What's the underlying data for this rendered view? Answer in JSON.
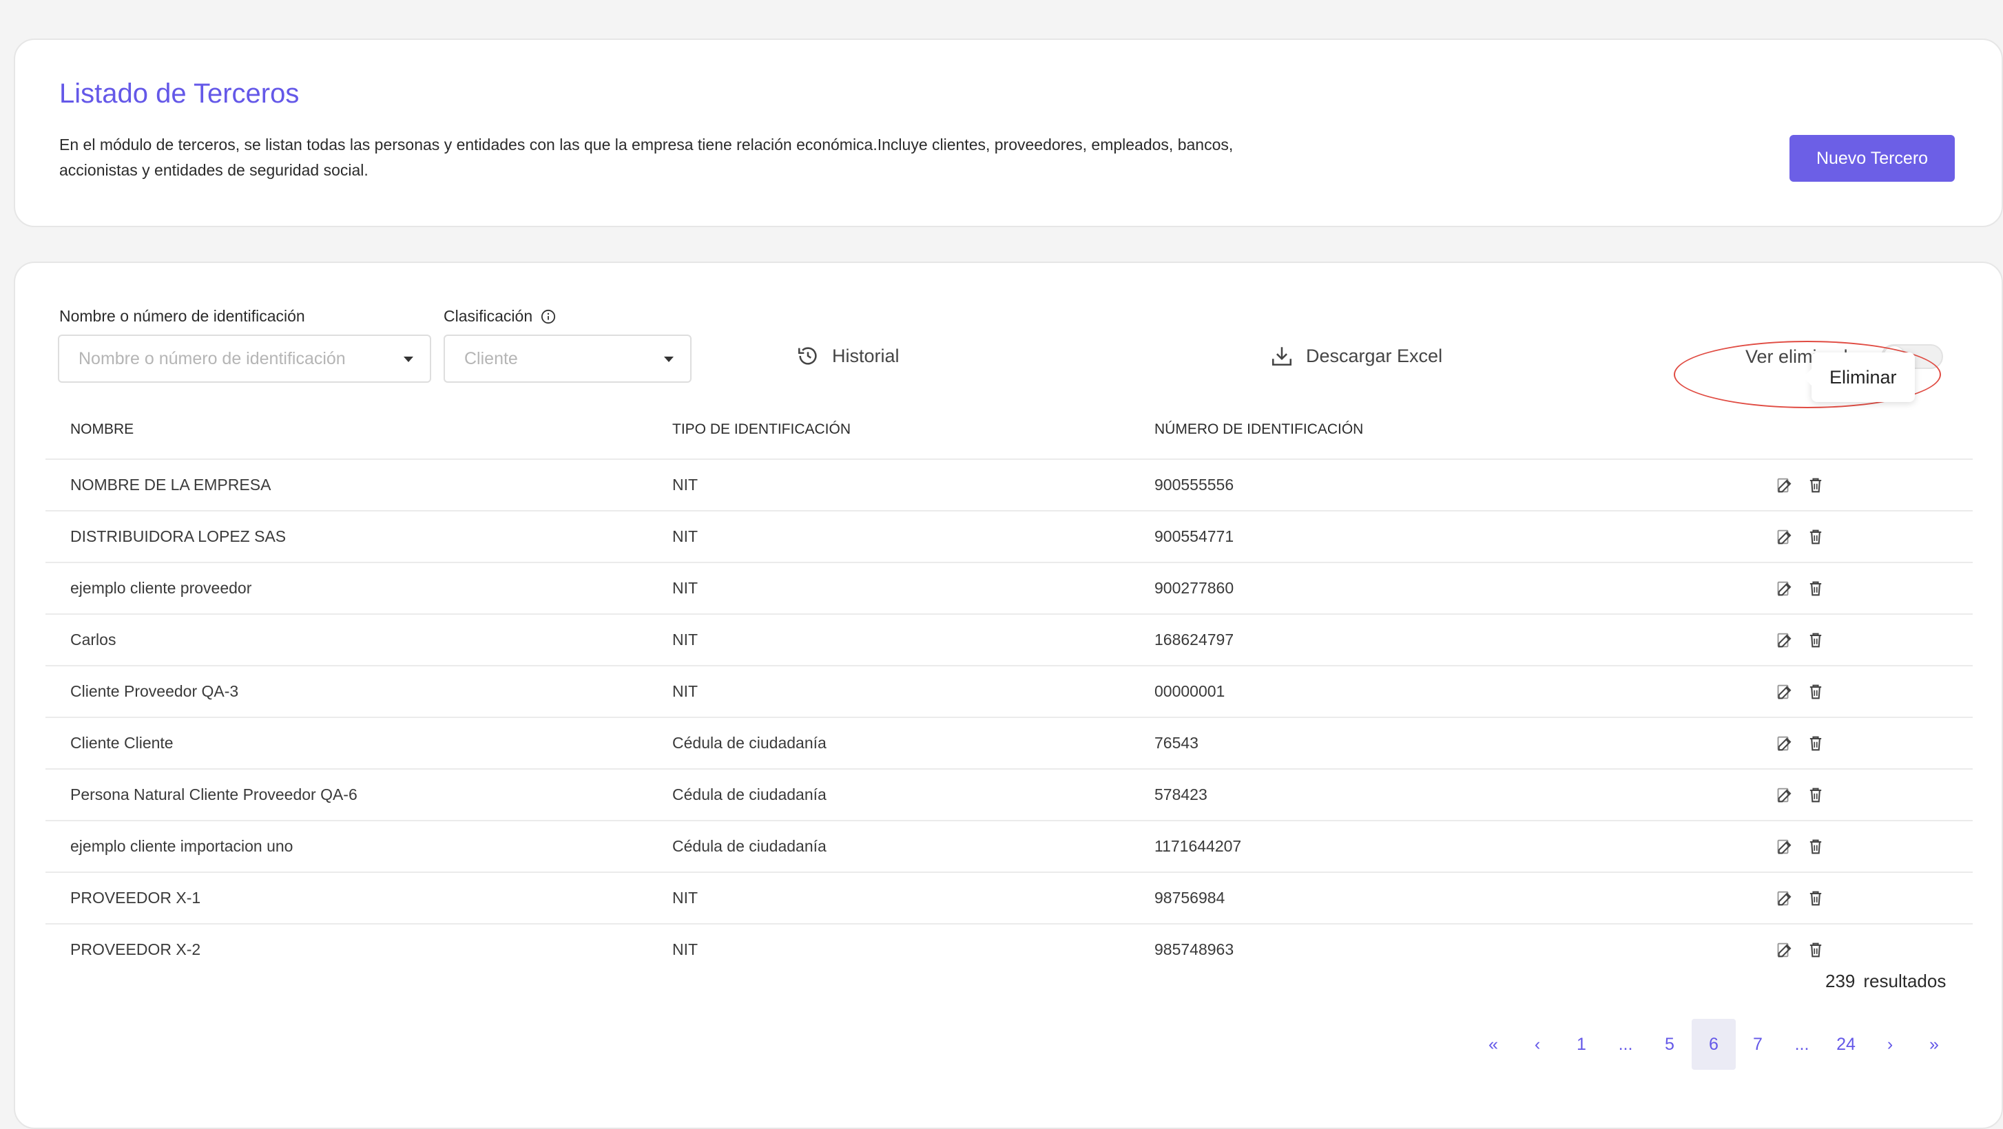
{
  "header": {
    "title": "Listado de Terceros",
    "description": "En el módulo de terceros, se listan todas las personas y entidades con las que la empresa tiene relación económica.Incluye clientes, proveedores, empleados, bancos, accionistas y entidades de seguridad social.",
    "new_button": "Nuevo Tercero"
  },
  "filters": {
    "search_label": "Nombre o número de identificación",
    "search_placeholder": "Nombre o número de identificación",
    "class_label": "Clasificación",
    "class_value": "Cliente",
    "history": "Historial",
    "download": "Descargar Excel",
    "show_deleted": "Ver eliminados"
  },
  "table": {
    "headers": [
      "NOMBRE",
      "TIPO DE IDENTIFICACIÓN",
      "NÚMERO DE IDENTIFICACIÓN"
    ],
    "rows": [
      {
        "name": "NOMBRE DE LA EMPRESA",
        "type": "NIT",
        "number": "900555556"
      },
      {
        "name": "DISTRIBUIDORA LOPEZ SAS",
        "type": "NIT",
        "number": "900554771"
      },
      {
        "name": "ejemplo cliente proveedor",
        "type": "NIT",
        "number": "900277860"
      },
      {
        "name": "Carlos",
        "type": "NIT",
        "number": "168624797"
      },
      {
        "name": "Cliente Proveedor QA-3",
        "type": "NIT",
        "number": "00000001"
      },
      {
        "name": "Cliente Cliente",
        "type": "Cédula de ciudadanía",
        "number": "76543"
      },
      {
        "name": "Persona Natural Cliente Proveedor QA-6",
        "type": "Cédula de ciudadanía",
        "number": "578423"
      },
      {
        "name": "ejemplo cliente importacion uno",
        "type": "Cédula de ciudadanía",
        "number": "1171644207"
      },
      {
        "name": "PROVEEDOR X-1",
        "type": "NIT",
        "number": "98756984"
      },
      {
        "name": "PROVEEDOR X-2",
        "type": "NIT",
        "number": "985748963"
      }
    ]
  },
  "tooltip": "Eliminar",
  "results": {
    "count": "239",
    "label": "resultados"
  },
  "pagination": [
    "«",
    "‹",
    "1",
    "...",
    "5",
    "6",
    "7",
    "...",
    "24",
    "›",
    "»"
  ],
  "pagination_active": "6",
  "colors": {
    "accent": "#6c5fe6",
    "highlight": "#e04b42"
  }
}
